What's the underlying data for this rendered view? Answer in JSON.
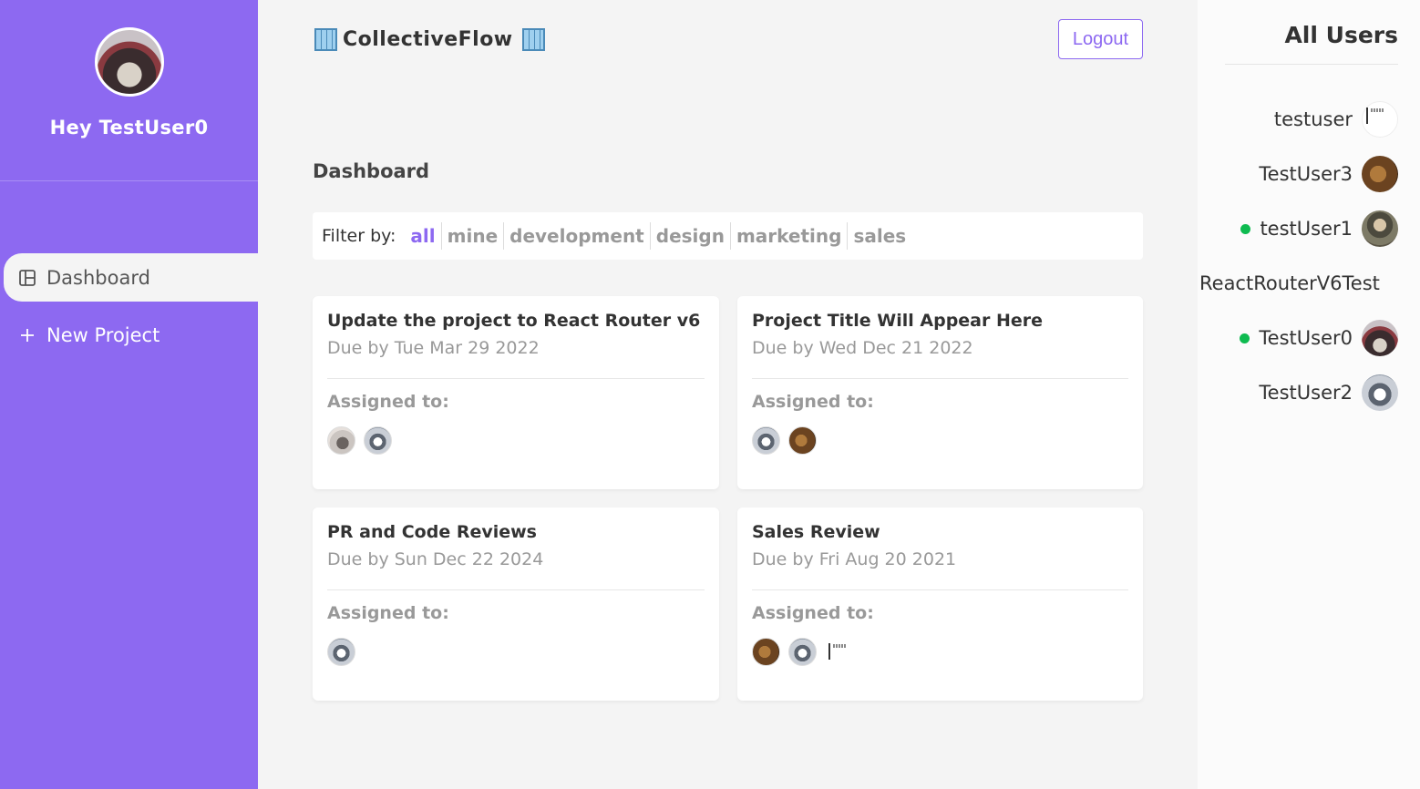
{
  "sidebar": {
    "greeting": "Hey TestUser0",
    "nav": [
      {
        "label": "Dashboard",
        "icon": "dashboard-icon",
        "active": true
      },
      {
        "label": "New Project",
        "icon": "plus-icon",
        "active": false
      }
    ]
  },
  "header": {
    "brand": "CollectiveFlow",
    "logout_label": "Logout"
  },
  "dashboard": {
    "title": "Dashboard",
    "filter_label": "Filter by:",
    "filters": [
      "all",
      "mine",
      "development",
      "design",
      "marketing",
      "sales"
    ],
    "active_filter": "all",
    "assigned_label": "Assigned to:",
    "projects": [
      {
        "title": "Update the project to React Router v6",
        "due": "Due by Tue Mar 29 2022"
      },
      {
        "title": "Project Title Will Appear Here",
        "due": "Due by Wed Dec 21 2022"
      },
      {
        "title": "PR and Code Reviews",
        "due": "Due by Sun Dec 22 2024"
      },
      {
        "title": "Sales Review",
        "due": "Due by Fri Aug 20 2021"
      }
    ]
  },
  "users_panel": {
    "title": "All Users",
    "users": [
      {
        "name": "testuser",
        "online": false
      },
      {
        "name": "TestUser3",
        "online": false
      },
      {
        "name": "testUser1",
        "online": true
      },
      {
        "name": "ReactRouterV6Test",
        "online": false
      },
      {
        "name": "TestUser0",
        "online": true
      },
      {
        "name": "TestUser2",
        "online": false
      }
    ]
  },
  "colors": {
    "accent": "#8d69f1",
    "online": "#0ebb50",
    "background": "#f4f4f4"
  }
}
